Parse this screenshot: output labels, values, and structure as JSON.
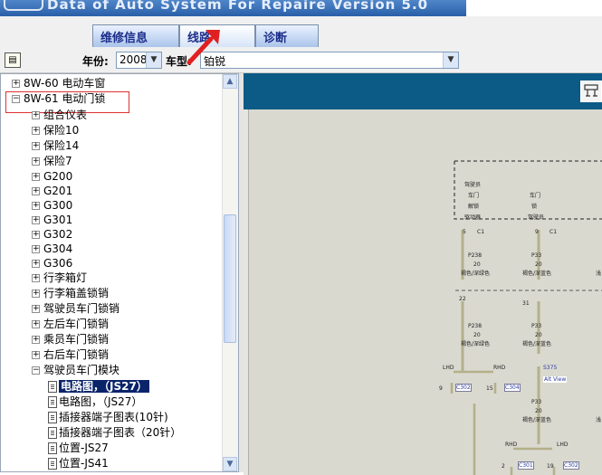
{
  "window": {
    "title": "Data of Auto System For Repaire Version 5.0"
  },
  "tabs": [
    {
      "label": "维修信息"
    },
    {
      "label": "线路"
    },
    {
      "label": "诊断"
    }
  ],
  "toolbar": {
    "year_label": "年份:",
    "year_value": "2008",
    "model_label": "车型:",
    "model_value": "铂锐"
  },
  "tree": {
    "items": [
      {
        "label": "8W-60 电动车窗"
      },
      {
        "label": "8W-61 电动门锁"
      },
      {
        "label": "组合仪表"
      },
      {
        "label": "保险10"
      },
      {
        "label": "保险14"
      },
      {
        "label": "保险7"
      },
      {
        "label": "G200"
      },
      {
        "label": "G201"
      },
      {
        "label": "G300"
      },
      {
        "label": "G301"
      },
      {
        "label": "G302"
      },
      {
        "label": "G304"
      },
      {
        "label": "G306"
      },
      {
        "label": "行李箱灯"
      },
      {
        "label": "行李箱盖锁销"
      },
      {
        "label": "驾驶员车门锁销"
      },
      {
        "label": "左后车门锁销"
      },
      {
        "label": "乘员车门锁销"
      },
      {
        "label": "右后车门锁销"
      },
      {
        "label": "驾驶员车门模块"
      },
      {
        "label": "电路图，（JS27）"
      },
      {
        "label": "电路图，（JS27）"
      },
      {
        "label": "插接器端子图表(10针)"
      },
      {
        "label": "插接器端子图表（20针）"
      },
      {
        "label": "位置-JS27"
      },
      {
        "label": "位置-JS41"
      }
    ]
  },
  "diagram": {
    "box_left": [
      "驾驶员",
      "车门",
      "解锁",
      "驱动器"
    ],
    "box_right": [
      "车门",
      "锁",
      "驾驶员"
    ],
    "pins": [
      "5",
      "C1",
      "9",
      "C1"
    ],
    "wire1": [
      "P238",
      "20",
      "褐色/深绿色"
    ],
    "wire2": [
      "P33",
      "20",
      "褐色/深蓝色"
    ],
    "wire3": [
      "P238",
      "20",
      "褐色/深绿色"
    ],
    "wire4": [
      "P33",
      "20",
      "褐色/深蓝色"
    ],
    "wire5": [
      "P33",
      "20",
      "褐色/深蓝色"
    ],
    "splice_a": "22",
    "splice_b": "31",
    "right_cut": "浅",
    "lhd1": "LHD",
    "rhd1": "RHD",
    "lhd_pin": "9",
    "lhd_conn": "C302",
    "rhd_pin": "15",
    "rhd_conn": "C304",
    "s_label": "S375",
    "alt_view": "Alt View",
    "rhd2": "RHD",
    "lhd2": "LHD",
    "pin2": "2",
    "conn2": "C301",
    "pin19": "19",
    "conn3": "C302"
  }
}
